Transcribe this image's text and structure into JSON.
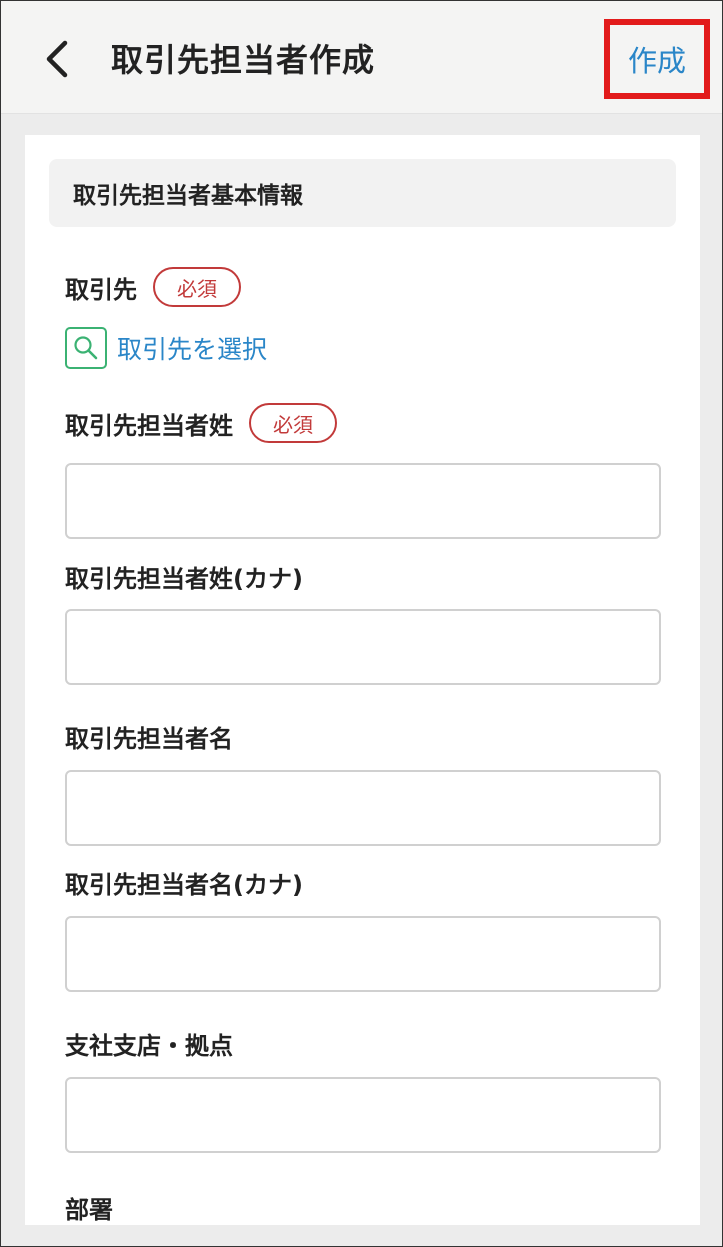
{
  "header": {
    "title": "取引先担当者作成",
    "create_label": "作成"
  },
  "section": {
    "title": "取引先担当者基本情報"
  },
  "fields": {
    "account": {
      "label": "取引先",
      "required": "必須",
      "select_label": "取引先を選択"
    },
    "last_name": {
      "label": "取引先担当者姓",
      "required": "必須",
      "value": ""
    },
    "last_name_kana": {
      "label": "取引先担当者姓(カナ)",
      "value": ""
    },
    "first_name": {
      "label": "取引先担当者名",
      "value": ""
    },
    "first_name_kana": {
      "label": "取引先担当者名(カナ)",
      "value": ""
    },
    "branch": {
      "label": "支社支店・拠点",
      "value": ""
    },
    "department": {
      "label": "部署"
    }
  },
  "colors": {
    "link": "#2a86c8",
    "required": "#c23a3a",
    "search_icon": "#3bb273",
    "highlight": "#e21b1b"
  },
  "icons": {
    "back": "chevron-left-icon",
    "search": "search-icon"
  }
}
